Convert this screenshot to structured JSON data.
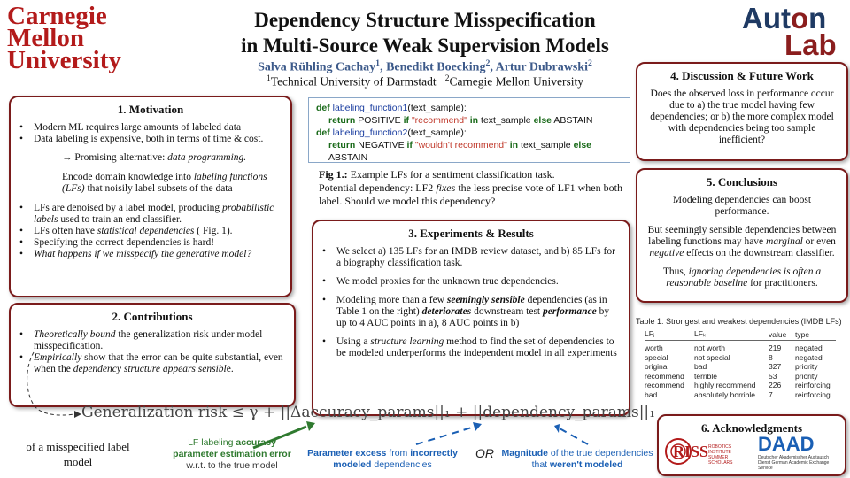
{
  "header": {
    "cmu_logo": [
      "Carnegie",
      "Mellon",
      "University"
    ],
    "title_line1": "Dependency Structure Misspecification",
    "title_line2": "in Multi-Source Weak Supervision Models",
    "authors": [
      {
        "name": "Salva Rühling Cachay",
        "sup": "1"
      },
      {
        "name": "Benedikt Boecking",
        "sup": "2"
      },
      {
        "name": "Artur Dubrawski",
        "sup": "2"
      }
    ],
    "affiliations": [
      {
        "sup": "1",
        "name": "Technical University of Darmstadt"
      },
      {
        "sup": "2",
        "name": "Carnegie Mellon University"
      }
    ],
    "auton_logo": {
      "top": "Aut",
      "dot": "o",
      "top_end": "n",
      "bottom": "Lab"
    }
  },
  "motivation": {
    "heading": "1. Motivation",
    "bullets_a": [
      "Modern ML requires large amounts of labeled data",
      "Data labeling  is expensive, both in terms of time & cost."
    ],
    "arrow_line_prefix": "→ Promising alternative: ",
    "arrow_line_em": "data programming.",
    "encode_pre": "Encode domain knowledge into ",
    "encode_em": "labeling functions (LFs)",
    "encode_post": "  that noisily label subsets of the data",
    "bullet_lf_pre": "LFs are denoised by a label model, producing ",
    "bullet_lf_em": "probabilistic labels",
    "bullet_lf_post": " used to train an end classifier.",
    "bullet_dep_pre": "LFs often have ",
    "bullet_dep_em": "statistical dependencies",
    "bullet_dep_post": " ( Fig. 1).",
    "bullet_spec": "Specifying the correct dependencies is hard!",
    "bullet_what": "What happens if we misspecify the generative model?"
  },
  "contributions": {
    "heading": "2. Contributions",
    "b1_em": "Theoretically bound",
    "b1_rest": " the generalization risk under model misspecification.",
    "b2_em": "Empirically",
    "b2_mid": " show that the error can be quite substantial, even when the ",
    "b2_em2": "dependency structure appears sensibl",
    "b2_end": "e."
  },
  "code": {
    "line1": {
      "kw": "def",
      "fn": "labeling_function1",
      "rest": "(text_sample):"
    },
    "line2": {
      "kw1": "return",
      "mid1": " POSITIVE ",
      "kw2": "if",
      "str": " \"recommend\" ",
      "kw3": "in",
      "mid2": " text_sample ",
      "kw4": "else",
      "mid3": " ABSTAIN"
    },
    "line3": {
      "kw": "def",
      "fn": "labeling_function2",
      "rest": "(text_sample):"
    },
    "line4": {
      "kw1": "return",
      "mid1": " NEGATIVE ",
      "kw2": "if",
      "str": " \"wouldn't recommend\" ",
      "kw3": "in",
      "mid2": " text_sample ",
      "kw4": "else",
      "mid3": " ABSTAIN"
    }
  },
  "figure_caption": {
    "label": "Fig 1.:",
    "line1": " Example LFs for a sentiment classification task.",
    "line2_pre": "Potential dependency:  LF2 ",
    "line2_em": "fixes",
    "line2_post": " the less precise vote of LF1 when both label. Should we model this dependency?"
  },
  "experiments": {
    "heading": "3. Experiments & Results",
    "b1": "We select a) 135 LFs for an IMDB review dataset, and  b) 85 LFs for a biography classification task.",
    "b2": "We model proxies for the unknown true dependencies.",
    "b3_pre": "Modeling more than a few ",
    "b3_em1": "seemingly sensible",
    "b3_mid": " dependencies (as in Table 1 on the right) ",
    "b3_em2": "deteriorates",
    "b3_mid2": " downstream test ",
    "b3_em3": "performance",
    "b3_post": " by up to 4 AUC points in a), 8 AUC points in b)",
    "b4_pre": "Using a ",
    "b4_em": "structure learning",
    "b4_post": " method to find the set of dependencies to be modeled underperforms the independent model in all experiments"
  },
  "discussion": {
    "heading": "4. Discussion & Future Work",
    "text": "Does the observed loss in performance occur due to a) the true model having few dependencies; or b) the more complex model with dependencies being too sample inefficient?"
  },
  "conclusions": {
    "heading": "5. Conclusions",
    "p1": "Modeling dependencies can boost performance.",
    "p2_pre": "But seemingly sensible dependencies between labeling functions may have ",
    "p2_em1": "marginal",
    "p2_mid": " or even ",
    "p2_em2": "negative",
    "p2_post": " effects on the downstream classifier.",
    "p3_pre": "Thus, ",
    "p3_em": "ignoring dependencies is often a reasonable baseline",
    "p3_post": " for practitioners."
  },
  "table": {
    "caption": "Table 1: Strongest and weakest dependencies (IMDB LFs)",
    "headers": [
      "LFⱼ",
      "LFₖ",
      "value",
      "type"
    ],
    "rows": [
      [
        "worth",
        "not worth",
        "219",
        "negated"
      ],
      [
        "special",
        "not special",
        "8",
        "negated"
      ],
      [
        "original",
        "bad",
        "327",
        "priority"
      ],
      [
        "recommend",
        "terrible",
        "53",
        "priority"
      ],
      [
        "recommend",
        "highly recommend",
        "226",
        "reinforcing"
      ],
      [
        "bad",
        "absolutely horrible",
        "7",
        "reinforcing"
      ]
    ]
  },
  "acknowledgments": {
    "heading": "6. Acknowledgments",
    "riss_logo": "RISS",
    "riss_sub": "ROBOTICS INSTITUTE SUMMER SCHOLARS",
    "daad_logo": "DAAD",
    "daad_sub": "Deutscher Akademischer Austausch Dienst German Academic Exchange Service"
  },
  "formula": {
    "text": "Generalization risk ≤ γ + ||Δaccuracy_params||₁ + ||dependency_params||₁",
    "misspecified_label": "of a misspecified label model",
    "green_pre": "LF labeling ",
    "green_bold": "accuracy parameter estimation error",
    "green_post": " w.r.t. to the true model",
    "blue1_bold": "Parameter excess",
    "blue1_mid": " from ",
    "blue1_bold2": "incorrectly modeled",
    "blue1_post": " dependencies",
    "or": "OR",
    "blue2_bold": "Magnitude",
    "blue2_mid": " of the true dependencies that ",
    "blue2_bold2": "weren't modeled"
  },
  "colors": {
    "box_border": "#7a1b1b",
    "cmu_red": "#b31b1b",
    "author_blue": "#3d5a8a",
    "green": "#2f7a2f",
    "blue": "#1a5fb4"
  }
}
